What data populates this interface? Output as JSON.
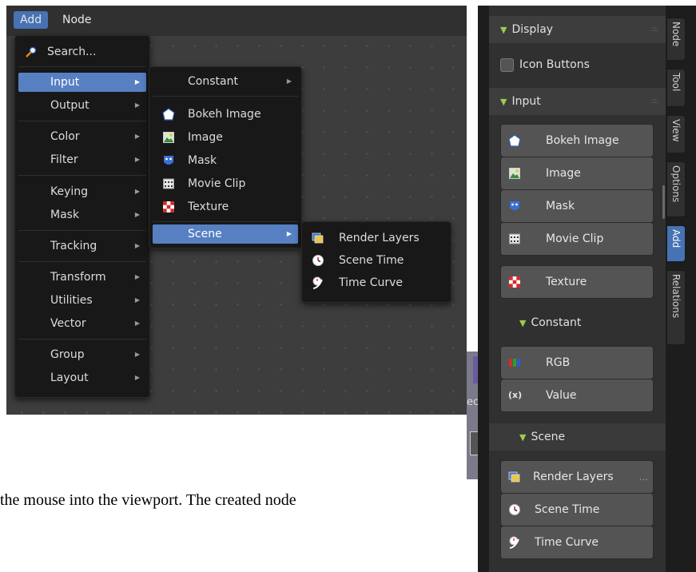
{
  "menubar": {
    "add": "Add",
    "node": "Node"
  },
  "add_menu": {
    "search": "Search...",
    "items": [
      "Input",
      "Output",
      "Color",
      "Filter",
      "Keying",
      "Mask",
      "Tracking",
      "Transform",
      "Utilities",
      "Vector",
      "Group",
      "Layout"
    ],
    "selected": "Input"
  },
  "input_submenu": {
    "items": [
      "Constant",
      "Bokeh Image",
      "Image",
      "Mask",
      "Movie Clip",
      "Texture",
      "Scene"
    ],
    "selected": "Scene"
  },
  "scene_submenu": {
    "items": [
      "Render Layers",
      "Scene Time",
      "Time Curve"
    ]
  },
  "caption": "the mouse into the viewport. The created node",
  "cut_text": "ec",
  "sidebar": {
    "display_header": "Display",
    "icon_buttons_label": "Icon Buttons",
    "input_header": "Input",
    "input_buttons": [
      "Bokeh Image",
      "Image",
      "Mask",
      "Movie Clip",
      "Texture"
    ],
    "constant_header": "Constant",
    "constant_buttons": [
      "RGB",
      "Value"
    ],
    "scene_header": "Scene",
    "scene_buttons": [
      "Render Layers",
      "Scene Time",
      "Time Curve"
    ],
    "more_dots": "...",
    "value_icon_text": "(x)",
    "tabs": [
      "Node",
      "Tool",
      "View",
      "Options",
      "Add",
      "Relations"
    ],
    "active_tab": "Add"
  },
  "colors": {
    "accent": "#4772b3",
    "highlight": "#5680c2",
    "panel_triangle": "#9ccc4a"
  }
}
